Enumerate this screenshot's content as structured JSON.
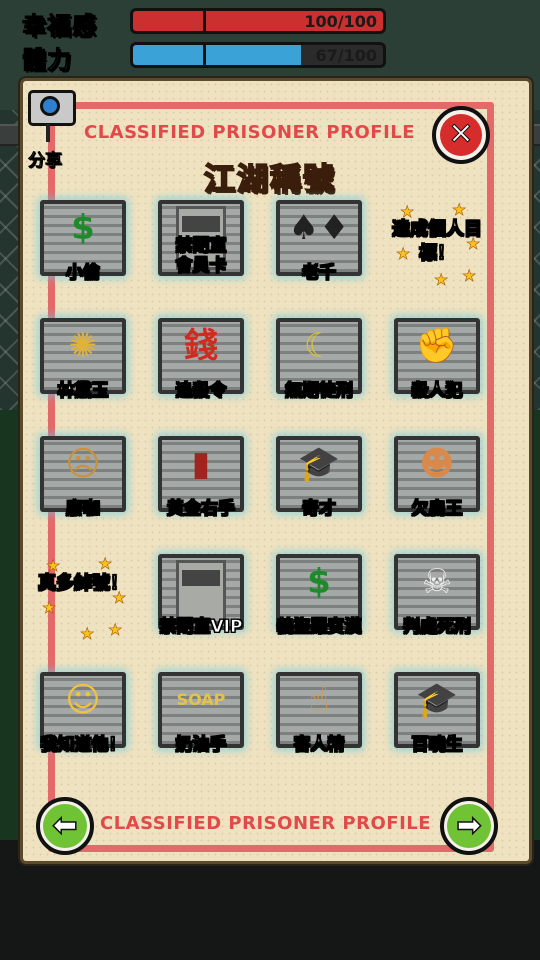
{
  "stats": [
    {
      "label": "幸福感",
      "text": "100/100",
      "value": 100,
      "max": 100,
      "color": "#cc2f2f",
      "label_color": "#e0463a"
    },
    {
      "label": "體力",
      "text": "67/100",
      "value": 67,
      "max": 100,
      "color": "#3aa2d6",
      "label_color": "#4fb0e6"
    }
  ],
  "share": {
    "label": "分享",
    "icon": "camera-icon"
  },
  "profile": {
    "header": "CLASSIFIED PRISONER PROFILE",
    "footer": "CLASSIFIED PRISONER PROFILE",
    "title": "江湖稱號",
    "close_symbol": "✕",
    "prev_symbol": "⬅",
    "next_symbol": "➡"
  },
  "badges": [
    {
      "label": "小偷",
      "icon": "money-hand-icon",
      "glyph": "$",
      "glyph_color": "#1f8a2c"
    },
    {
      "label": "禁閉室會員卡",
      "icon": "solitary-door-icon",
      "glyph": "",
      "glyph_color": "#555"
    },
    {
      "label": "老千",
      "icon": "cards-hand-icon",
      "glyph": "♠♦",
      "glyph_color": "#222"
    },
    {
      "label": "達成個人目標！",
      "icon": "starburst-icon",
      "glyph": "",
      "glyph_color": "#fff"
    },
    {
      "label": "林黛玉",
      "icon": "popcorn-icon",
      "glyph": "✺",
      "glyph_color": "#e0b13b"
    },
    {
      "label": "追殺令",
      "icon": "coin-seal-icon",
      "glyph": "錢",
      "glyph_color": "#d12a1f"
    },
    {
      "label": "無期徒刑",
      "icon": "cell-bars-icon",
      "glyph": "☾",
      "glyph_color": "#d8c23a"
    },
    {
      "label": "殺人犯",
      "icon": "knife-fist-icon",
      "glyph": "✊",
      "glyph_color": "#c94a2c"
    },
    {
      "label": "廢咖",
      "icon": "bandaged-face-icon",
      "glyph": "☹",
      "glyph_color": "#c9923a"
    },
    {
      "label": "黃金右手",
      "icon": "magazine-icon",
      "glyph": "▮",
      "glyph_color": "#a1241e"
    },
    {
      "label": "奇才",
      "icon": "grad-cap-icon",
      "glyph": "🎓",
      "glyph_color": "#111"
    },
    {
      "label": "欠扁王",
      "icon": "old-man-icon",
      "glyph": "☻",
      "glyph_color": "#d98a4a"
    },
    {
      "label": "真多綽號！",
      "icon": "starburst-icon",
      "glyph": "",
      "glyph_color": "#fff"
    },
    {
      "label": "禁閉室VIP",
      "icon": "solitary-door-icon",
      "glyph": "",
      "glyph_color": "#555"
    },
    {
      "label": "義盜羅賓漢",
      "icon": "money-hand-icon",
      "glyph": "$",
      "glyph_color": "#1f8a2c"
    },
    {
      "label": "判處死刑",
      "icon": "skull-prisoner-icon",
      "glyph": "☠",
      "glyph_color": "#eee"
    },
    {
      "label": "我知道他！",
      "icon": "blonde-girl-icon",
      "glyph": "☺",
      "glyph_color": "#f2c23a"
    },
    {
      "label": "奶油手",
      "icon": "soap-icon",
      "glyph": "SOAP",
      "glyph_color": "#e8c14a"
    },
    {
      "label": "害人精",
      "icon": "pointing-fist-icon",
      "glyph": "☝",
      "glyph_color": "#d79a48"
    },
    {
      "label": "百曉生",
      "icon": "grad-cap-icon",
      "glyph": "🎓",
      "glyph_color": "#111"
    }
  ]
}
